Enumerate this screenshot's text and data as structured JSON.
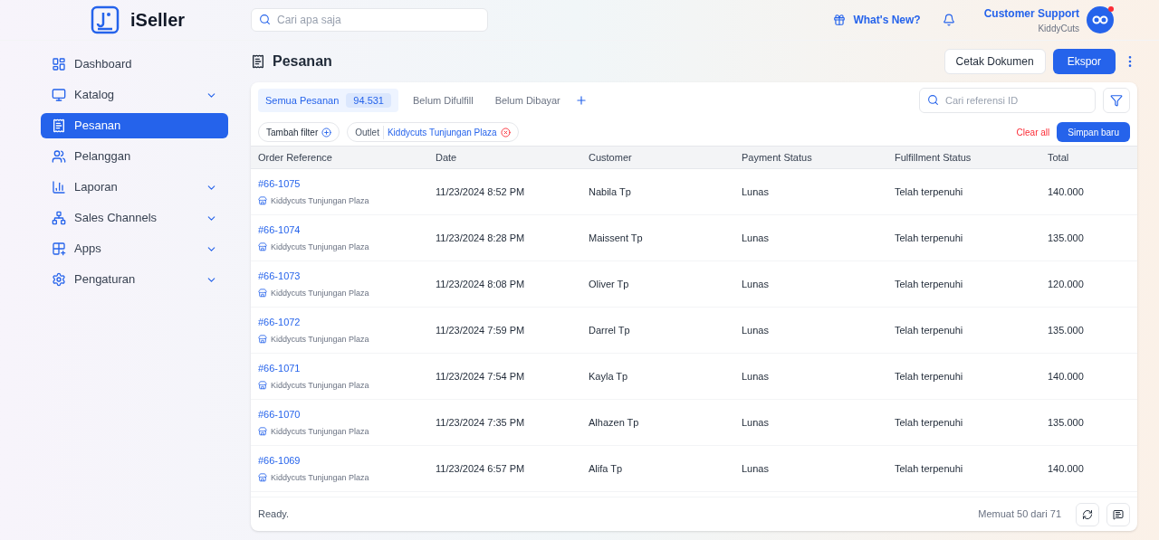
{
  "brand": {
    "name": "iSeller"
  },
  "search": {
    "placeholder": "Cari apa saja"
  },
  "header": {
    "whats_new": "What's New?",
    "user_name": "Customer Support",
    "user_store": "KiddyCuts",
    "notification": true
  },
  "sidebar": {
    "items": [
      {
        "label": "Dashboard",
        "expandable": false,
        "selected": false
      },
      {
        "label": "Katalog",
        "expandable": true,
        "selected": false
      },
      {
        "label": "Pesanan",
        "expandable": false,
        "selected": true
      },
      {
        "label": "Pelanggan",
        "expandable": false,
        "selected": false
      },
      {
        "label": "Laporan",
        "expandable": true,
        "selected": false
      },
      {
        "label": "Sales Channels",
        "expandable": true,
        "selected": false
      },
      {
        "label": "Apps",
        "expandable": true,
        "selected": false
      },
      {
        "label": "Pengaturan",
        "expandable": true,
        "selected": false
      }
    ]
  },
  "page": {
    "title": "Pesanan",
    "buttons": [
      "Cetak Dokumen",
      "Ekspor"
    ]
  },
  "tabs": [
    {
      "label": "Semua Pesanan",
      "count": "94.531",
      "selected": true
    },
    {
      "label": "Belum Difulfill",
      "selected": false
    },
    {
      "label": "Belum Dibayar",
      "selected": false
    }
  ],
  "ref_search": {
    "placeholder": "Cari referensi ID"
  },
  "filters": {
    "add": "Tambah filter",
    "chips": [
      {
        "name": "Outlet",
        "value": "Kiddycuts Tunjungan Plaza"
      }
    ],
    "clear": "Clear all",
    "save": "Simpan baru"
  },
  "table": {
    "columns": [
      "Order Reference",
      "Date",
      "Customer",
      "Payment Status",
      "Fulfillment Status",
      "Total"
    ],
    "rows": [
      {
        "order": "#66-1075",
        "outlet": "Kiddycuts Tunjungan Plaza",
        "date": "11/23/2024 8:52 PM",
        "customer": "Nabila Tp",
        "payment": "Lunas",
        "fulfillment": "Telah terpenuhi",
        "total": "140.000"
      },
      {
        "order": "#66-1074",
        "outlet": "Kiddycuts Tunjungan Plaza",
        "date": "11/23/2024 8:28 PM",
        "customer": "Maissent Tp",
        "payment": "Lunas",
        "fulfillment": "Telah terpenuhi",
        "total": "135.000"
      },
      {
        "order": "#66-1073",
        "outlet": "Kiddycuts Tunjungan Plaza",
        "date": "11/23/2024 8:08 PM",
        "customer": "Oliver Tp",
        "payment": "Lunas",
        "fulfillment": "Telah terpenuhi",
        "total": "120.000"
      },
      {
        "order": "#66-1072",
        "outlet": "Kiddycuts Tunjungan Plaza",
        "date": "11/23/2024 7:59 PM",
        "customer": "Darrel Tp",
        "payment": "Lunas",
        "fulfillment": "Telah terpenuhi",
        "total": "135.000"
      },
      {
        "order": "#66-1071",
        "outlet": "Kiddycuts Tunjungan Plaza",
        "date": "11/23/2024 7:54 PM",
        "customer": "Kayla Tp",
        "payment": "Lunas",
        "fulfillment": "Telah terpenuhi",
        "total": "140.000"
      },
      {
        "order": "#66-1070",
        "outlet": "Kiddycuts Tunjungan Plaza",
        "date": "11/23/2024 7:35 PM",
        "customer": "Alhazen Tp",
        "payment": "Lunas",
        "fulfillment": "Telah terpenuhi",
        "total": "135.000"
      },
      {
        "order": "#66-1069",
        "outlet": "Kiddycuts Tunjungan Plaza",
        "date": "11/23/2024 6:57 PM",
        "customer": "Alifa Tp",
        "payment": "Lunas",
        "fulfillment": "Telah terpenuhi",
        "total": "140.000"
      }
    ]
  },
  "footer": {
    "status": "Ready.",
    "loaded": "Memuat 50 dari 71"
  }
}
